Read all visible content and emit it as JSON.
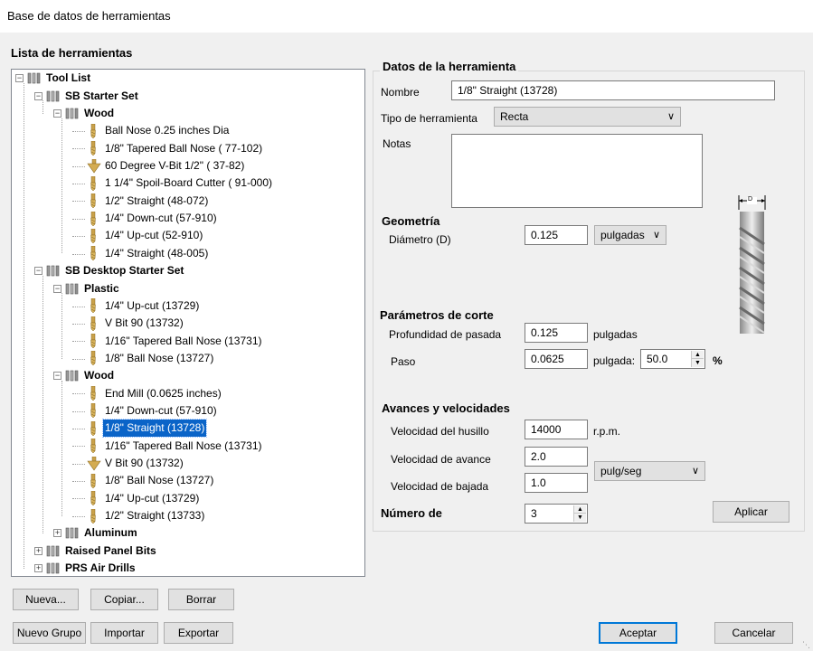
{
  "window": {
    "title": "Base de datos de herramientas"
  },
  "tree_panel": {
    "label": "Lista de herramientas",
    "nodes": [
      {
        "label": "Tool List",
        "level": 0,
        "type": "folder",
        "expanded": true
      },
      {
        "label": "SB Starter Set",
        "level": 1,
        "type": "folder",
        "expanded": true
      },
      {
        "label": "Wood",
        "level": 2,
        "type": "folder",
        "expanded": true
      },
      {
        "label": "Ball Nose 0.25 inches Dia",
        "level": 3,
        "type": "tool"
      },
      {
        "label": "1/8\" Tapered Ball Nose ( 77-102)",
        "level": 3,
        "type": "tool"
      },
      {
        "label": "60 Degree V-Bit 1/2\"  ( 37-82)",
        "level": 3,
        "type": "vbit"
      },
      {
        "label": "1 1/4\" Spoil-Board Cutter ( 91-000)",
        "level": 3,
        "type": "tool"
      },
      {
        "label": "1/2\" Straight  (48-072)",
        "level": 3,
        "type": "tool"
      },
      {
        "label": "1/4\"  Down-cut (57-910)",
        "level": 3,
        "type": "tool"
      },
      {
        "label": "1/4\" Up-cut (52-910)",
        "level": 3,
        "type": "tool"
      },
      {
        "label": "1/4\" Straight  (48-005)",
        "level": 3,
        "type": "tool"
      },
      {
        "label": "SB Desktop Starter Set",
        "level": 1,
        "type": "folder",
        "expanded": true
      },
      {
        "label": "Plastic",
        "level": 2,
        "type": "folder",
        "expanded": true
      },
      {
        "label": "1/4\" Up-cut (13729)",
        "level": 3,
        "type": "tool"
      },
      {
        "label": "V Bit 90 (13732)",
        "level": 3,
        "type": "tool"
      },
      {
        "label": "1/16\" Tapered Ball Nose (13731)",
        "level": 3,
        "type": "tool"
      },
      {
        "label": "1/8\" Ball Nose (13727)",
        "level": 3,
        "type": "tool"
      },
      {
        "label": "Wood",
        "level": 2,
        "type": "folder",
        "expanded": true
      },
      {
        "label": "End Mill (0.0625 inches)",
        "level": 3,
        "type": "tool"
      },
      {
        "label": "1/4\"  Down-cut (57-910)",
        "level": 3,
        "type": "tool"
      },
      {
        "label": "1/8\" Straight (13728)",
        "level": 3,
        "type": "tool",
        "selected": true
      },
      {
        "label": "1/16\" Tapered Ball Nose (13731)",
        "level": 3,
        "type": "tool"
      },
      {
        "label": "V Bit 90 (13732)",
        "level": 3,
        "type": "vbit"
      },
      {
        "label": "1/8\" Ball Nose (13727)",
        "level": 3,
        "type": "tool"
      },
      {
        "label": "1/4\" Up-cut (13729)",
        "level": 3,
        "type": "tool"
      },
      {
        "label": "1/2\" Straight (13733)",
        "level": 3,
        "type": "tool"
      },
      {
        "label": "Aluminum",
        "level": 2,
        "type": "folder",
        "expanded": false
      },
      {
        "label": "Raised Panel Bits",
        "level": 1,
        "type": "folder",
        "expanded": false
      },
      {
        "label": "PRS Air Drills",
        "level": 1,
        "type": "folder",
        "expanded": false
      }
    ]
  },
  "details": {
    "group_label": "Datos de la herramienta",
    "name_label": "Nombre",
    "name_value": "1/8\" Straight (13728)",
    "tool_type_label": "Tipo de herramienta",
    "tool_type_value": "Recta",
    "notes_label": "Notas",
    "notes_value": "",
    "geometry": {
      "heading": "Geometría",
      "diameter_label": "Diámetro (D)",
      "diameter_value": "0.125",
      "units_value": "pulgadas",
      "diagram_d_label": "D"
    },
    "cutting": {
      "heading": "Parámetros de corte",
      "depth_label": "Profundidad de pasada",
      "depth_value": "0.125",
      "depth_unit": "pulgadas",
      "stepover_label": "Paso",
      "stepover_value": "0.0625",
      "stepover_unit": "pulgada:",
      "stepover_percent_value": "50.0",
      "percent_symbol": "%"
    },
    "feeds": {
      "heading": "Avances y velocidades",
      "spindle_label": "Velocidad del husillo",
      "spindle_value": "14000",
      "spindle_unit": "r.p.m.",
      "feed_label": "Velocidad de avance",
      "feed_value": "2.0",
      "plunge_label": "Velocidad de bajada",
      "plunge_value": "1.0",
      "rate_unit_value": "pulg/seg"
    },
    "tool_number_label": "Número de",
    "tool_number_value": "3",
    "apply_label": "Aplicar"
  },
  "buttons": {
    "new": "Nueva...",
    "copy": "Copiar...",
    "delete": "Borrar",
    "new_group": "Nuevo Grupo",
    "import": "Importar",
    "export": "Exportar",
    "ok": "Aceptar",
    "cancel": "Cancelar"
  }
}
